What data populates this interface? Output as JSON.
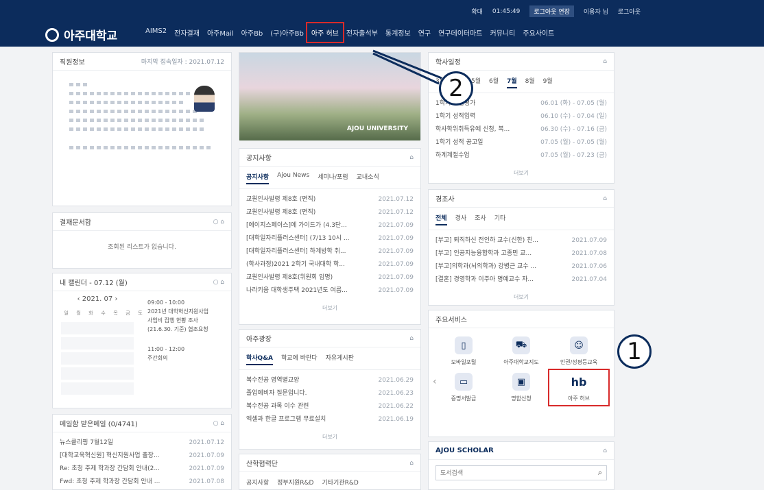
{
  "header": {
    "util": [
      "확대",
      "01:45:49",
      "로그아웃 연장",
      "이용자 님",
      "로그아웃"
    ],
    "logo": "아주대학교",
    "nav": [
      "AIMS2",
      "전자결재",
      "아주Mail",
      "아주Bb",
      "(구)아주Bb",
      "아주 허브",
      "전자출석부",
      "통계정보",
      "연구",
      "연구데이터마트",
      "커뮤니티",
      "주요사이트"
    ]
  },
  "profile": {
    "title": "직원정보",
    "last_login": "마지막 접속일자 : 2021.07.12"
  },
  "approval": {
    "title": "결재문서함",
    "empty": "조회된 리스트가 없습니다."
  },
  "calendar": {
    "title": "내 캘린더 - 07.12 (월)",
    "month": "2021. 07",
    "events": [
      "09:00 - 10:00",
      "2021년 대학혁신지원사업 사업비 집행 현황 조사(21.6.30. 기준) 협조요청",
      "11:00 - 12:00",
      "주간회의"
    ],
    "days": [
      "일",
      "월",
      "화",
      "수",
      "목",
      "금",
      "토"
    ]
  },
  "mail": {
    "title": "메일함 받은메일 (0/4741)",
    "items": [
      {
        "t": "뉴스클리핑 7월12일",
        "d": "2021.07.12"
      },
      {
        "t": "[대학교육혁신원] 혁신지원사업 출장...",
        "d": "2021.07.09"
      },
      {
        "t": "Re: 초청 주제 학과장 간담회 안내(2...",
        "d": "2021.07.09"
      },
      {
        "t": "Fwd: 초청 주제 학과장 간담회 안내 ...",
        "d": "2021.07.08"
      }
    ]
  },
  "banner": {
    "label": "AJOU UNIVERSITY"
  },
  "notice": {
    "title": "공지사항",
    "tabs": [
      "공지사항",
      "Ajou News",
      "세미나/포럼",
      "교내소식"
    ],
    "items": [
      {
        "t": "교원인사발령 제8호 (면직)",
        "d": "2021.07.12"
      },
      {
        "t": "교원인사발령 제8호 (면직)",
        "d": "2021.07.12"
      },
      {
        "t": "[에이지스페이스]에 가이드가 (4.3단...",
        "d": "2021.07.09"
      },
      {
        "t": "[대학일자리플러스센터] (7/13 10시 ...",
        "d": "2021.07.09"
      },
      {
        "t": "[대학일자리플러스센터] 하계방학 취...",
        "d": "2021.07.09"
      },
      {
        "t": "(학사과정)2021 2학기 국내대학 학...",
        "d": "2021.07.09"
      },
      {
        "t": "교원인사발령 제8호(위원회 임명)",
        "d": "2021.07.09"
      },
      {
        "t": "나라키움 대학생주택 2021년도 여름...",
        "d": "2021.07.09"
      }
    ],
    "more": "더보기"
  },
  "ajou_board": {
    "title": "아주광장",
    "tabs": [
      "학사Q&A",
      "학교에 바란다",
      "자유게시판"
    ],
    "items": [
      {
        "t": "복수전공 영역별교양",
        "d": "2021.06.29"
      },
      {
        "t": "졸업예비자 질문입니다.",
        "d": "2021.06.23"
      },
      {
        "t": "복수전공 과목 이수 관련",
        "d": "2021.06.22"
      },
      {
        "t": "엑셀과 한글 프로그램 무료설치",
        "d": "2021.06.19"
      }
    ],
    "more": "더보기"
  },
  "industry": {
    "title": "산학협력단",
    "tabs": [
      "공지사항",
      "정부지원R&D",
      "기타기관R&D"
    ]
  },
  "schedule": {
    "title": "학사일정",
    "months": [
      "3월",
      "4월",
      "5월",
      "6월",
      "7월",
      "8월",
      "9월"
    ],
    "items": [
      {
        "t": "1학기 수업평가",
        "d": "06.01 (화) - 07.05 (월)"
      },
      {
        "t": "1학기 성적입력",
        "d": "06.10 (수) - 07.04 (일)"
      },
      {
        "t": "학사학위취득유예 신청, 복...",
        "d": "06.30 (수) - 07.16 (금)"
      },
      {
        "t": "1학기 성적 공고일",
        "d": "07.05 (월) - 07.05 (월)"
      },
      {
        "t": "하계계절수업",
        "d": "07.05 (월) - 07.23 (금)"
      }
    ],
    "more": "더보기"
  },
  "events": {
    "title": "경조사",
    "tabs": [
      "전체",
      "경사",
      "조사",
      "기타"
    ],
    "items": [
      {
        "t": "[부고] 퇴직하신 전인하 교수(신한) 친...",
        "d": "2021.07.09"
      },
      {
        "t": "[부고] 인공지능융합학과 고종민 교...",
        "d": "2021.07.08"
      },
      {
        "t": "[부고]의학과(뇌의학과) 강병근 교수 ...",
        "d": "2021.07.06"
      },
      {
        "t": "[결혼] 경영학과 이주아 명예교수 자...",
        "d": "2021.07.04"
      }
    ],
    "more": "더보기"
  },
  "services": {
    "title": "주요서비스",
    "items": [
      "모바일포털",
      "아주대학교지도",
      "인권/성평등교육",
      "증명서발급",
      "명함신청",
      "아주 허브"
    ]
  },
  "scholar": {
    "title": "AJOU SCHOLAR",
    "placeholder": "도서검색"
  },
  "callouts": [
    "1",
    "2"
  ]
}
